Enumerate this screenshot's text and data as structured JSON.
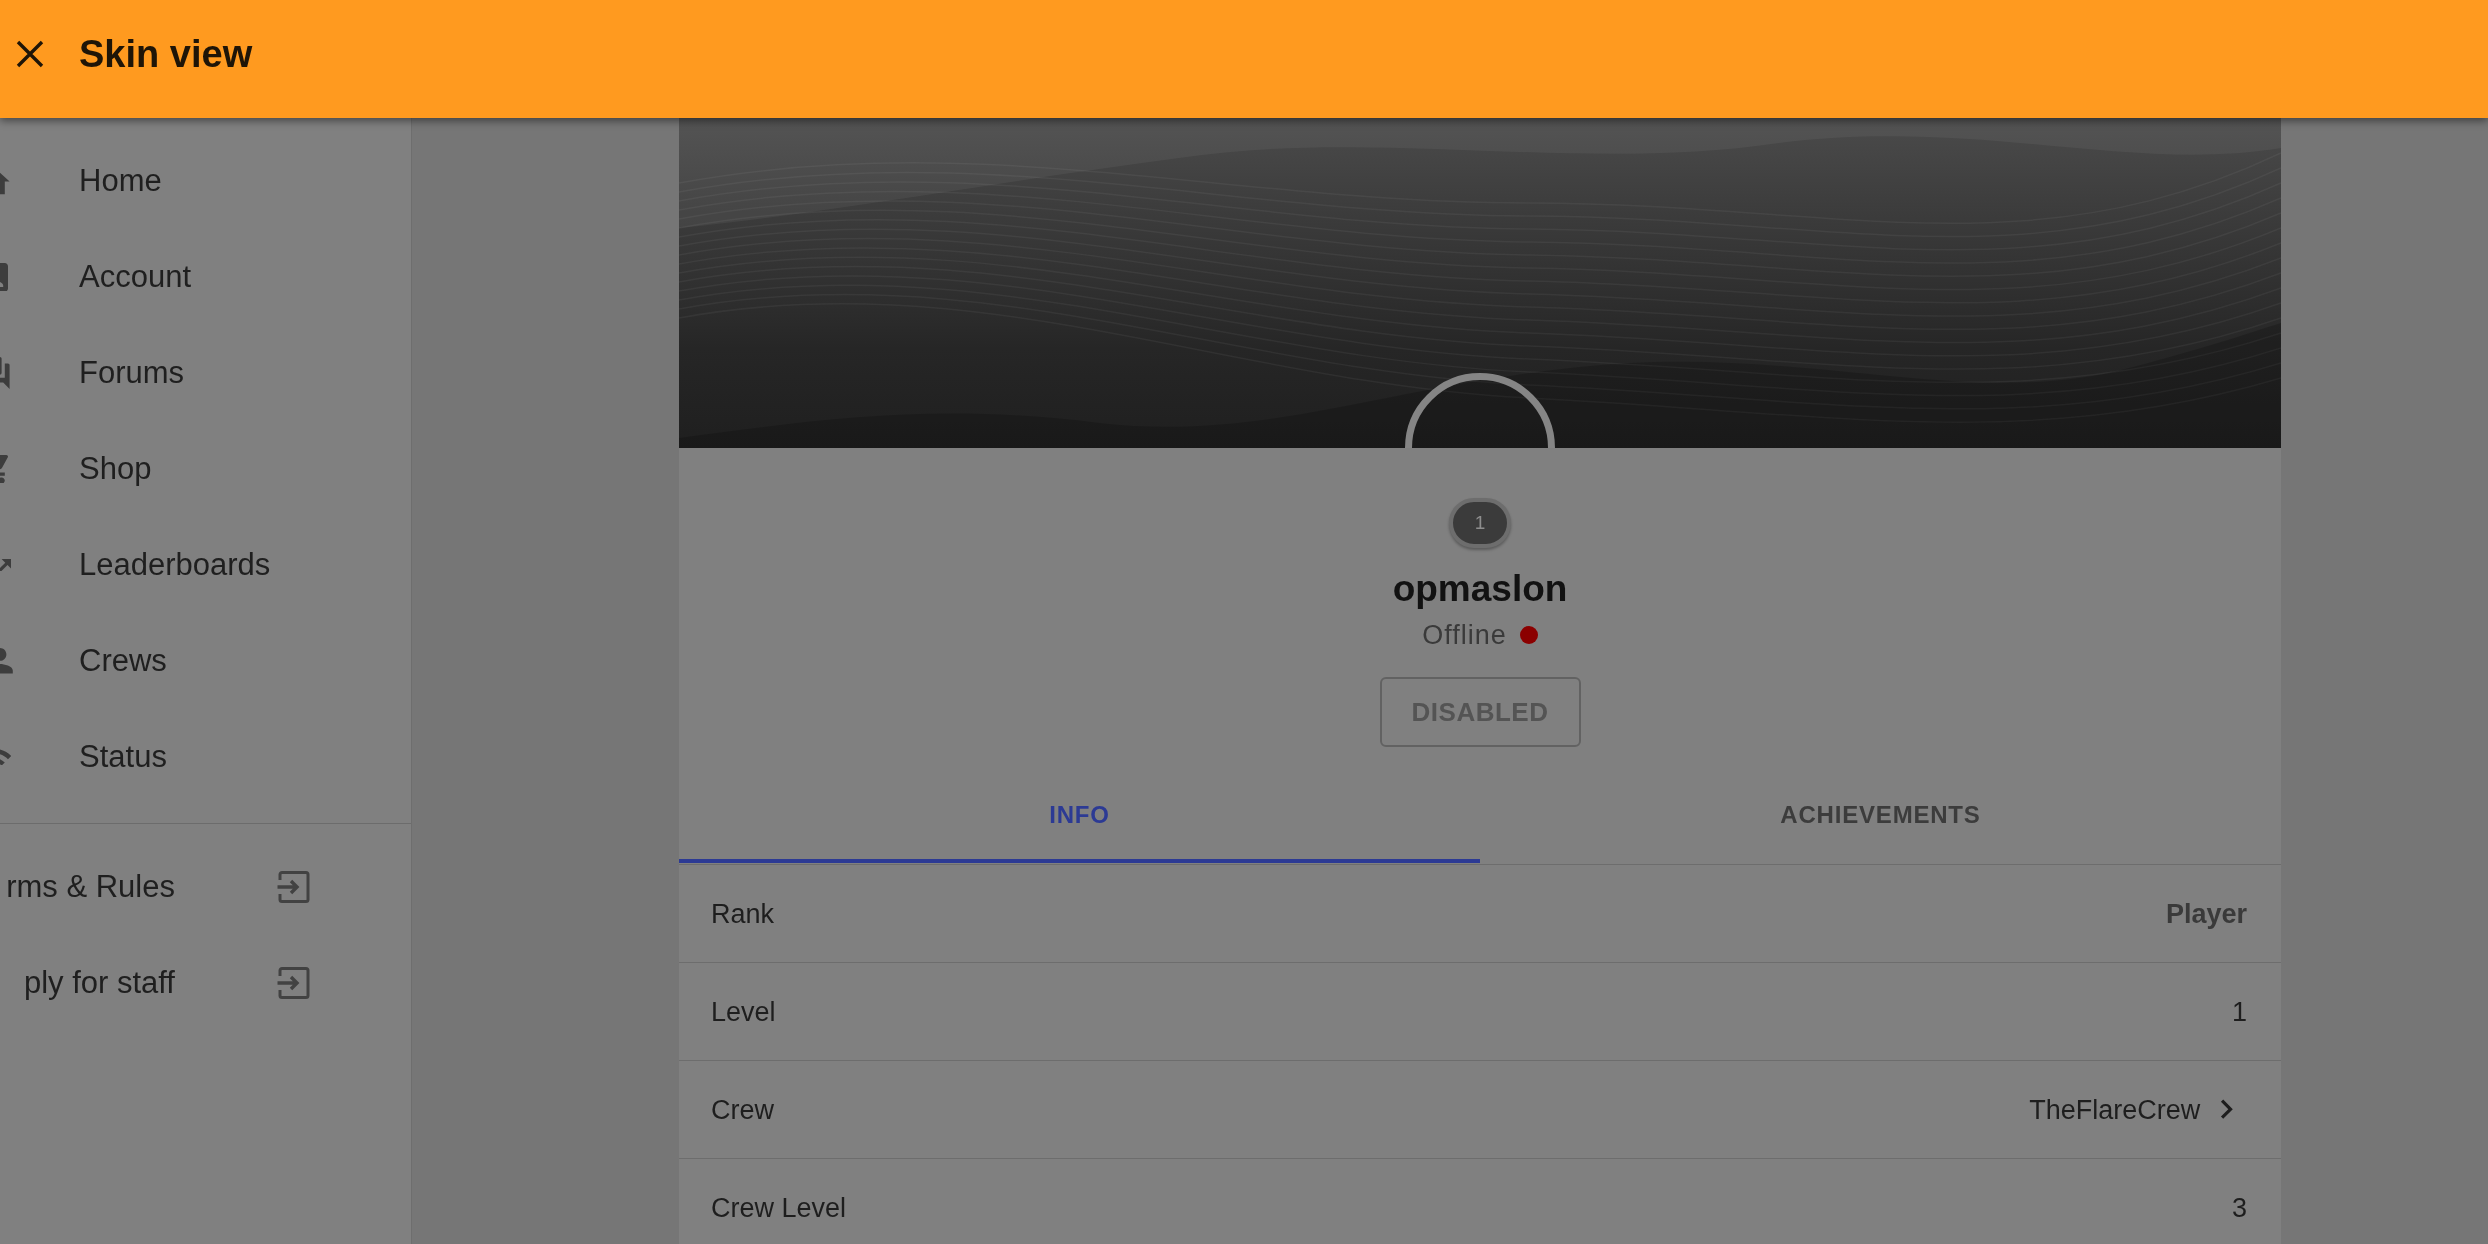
{
  "app_bar": {
    "title": "Skin view"
  },
  "sidebar": {
    "items": [
      {
        "label": "Home",
        "selected": false
      },
      {
        "label": "Account",
        "selected": false
      },
      {
        "label": "Forums",
        "selected": false
      },
      {
        "label": "Shop",
        "selected": false
      },
      {
        "label": "Leaderboards",
        "selected": false
      },
      {
        "label": "Crews",
        "selected": false
      },
      {
        "label": "Status",
        "selected": false
      }
    ],
    "links": [
      {
        "label": "rms & Rules"
      },
      {
        "label": "ply for staff"
      }
    ]
  },
  "profile": {
    "level_badge": "1",
    "username": "opmaslon",
    "status": {
      "label": "Offline",
      "color": "#8b0000"
    },
    "action_button": {
      "label": "DISABLED",
      "disabled": true
    }
  },
  "tabs": [
    {
      "label": "INFO",
      "selected": true
    },
    {
      "label": "ACHIEVEMENTS",
      "selected": false
    }
  ],
  "info_rows": [
    {
      "label": "Rank",
      "value": "Player",
      "kind": "emphasis"
    },
    {
      "label": "Level",
      "value": "1",
      "kind": "plain"
    },
    {
      "label": "Crew",
      "value": "TheFlareCrew",
      "kind": "link"
    },
    {
      "label": "Crew Level",
      "value": "3",
      "kind": "plain"
    }
  ]
}
